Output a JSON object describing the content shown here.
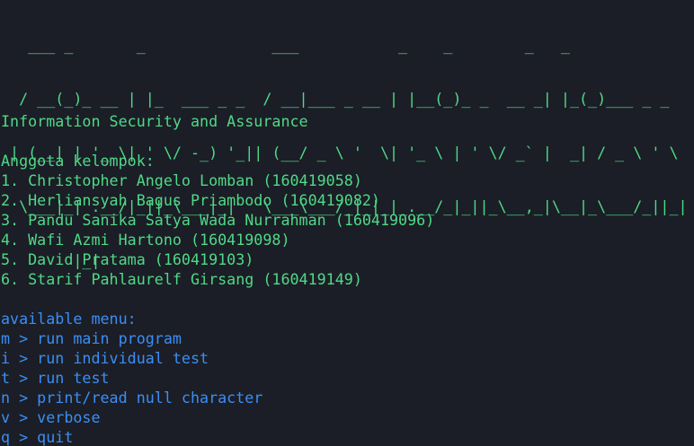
{
  "banner": {
    "lines": [
      "   ___ _       _              ___           _    _        _   _        ",
      "  / __(_)_ __ | |_  ___ _ _  / __|___ _ __ | |__(_)_ _  __ _| |_(_)___ _ _ ",
      " | (__| | '_ \\| ' \\/ -_) '_|| (__/ _ \\ '  \\| '_ \\ | ' \\/ _` |  _| / _ \\ ' \\",
      "  \\___|_| .__/|_||_\\___|_|   \\___\\___/_|_|_|_.__/_|_||_\\__,_|\\__|_\\___/_||_|",
      "        |_|                                                              "
    ]
  },
  "subtitle": "Information Security and Assurance",
  "members_heading": "Anggota kelompok:",
  "members": [
    "1. Christopher Angelo Lomban (160419058)",
    "2. Herliansyah Bagus Priambodo (160419082)",
    "3. Pandu Sanika Satya Wada Nurrahman (160419096)",
    "4. Wafi Azmi Hartono (160419098)",
    "5. David Pratama (160419103)",
    "6. Starif Pahlaurelf Girsang (160419149)"
  ],
  "menu_heading": "available menu:",
  "menu_items": [
    "m > run main program",
    "i > run individual test",
    "t > run test",
    "n > print/read null character",
    "v > verbose",
    "q > quit"
  ],
  "colors": {
    "background": "#1b1e26",
    "green_text": "#4fd987",
    "blue_text": "#3b8ef5"
  }
}
